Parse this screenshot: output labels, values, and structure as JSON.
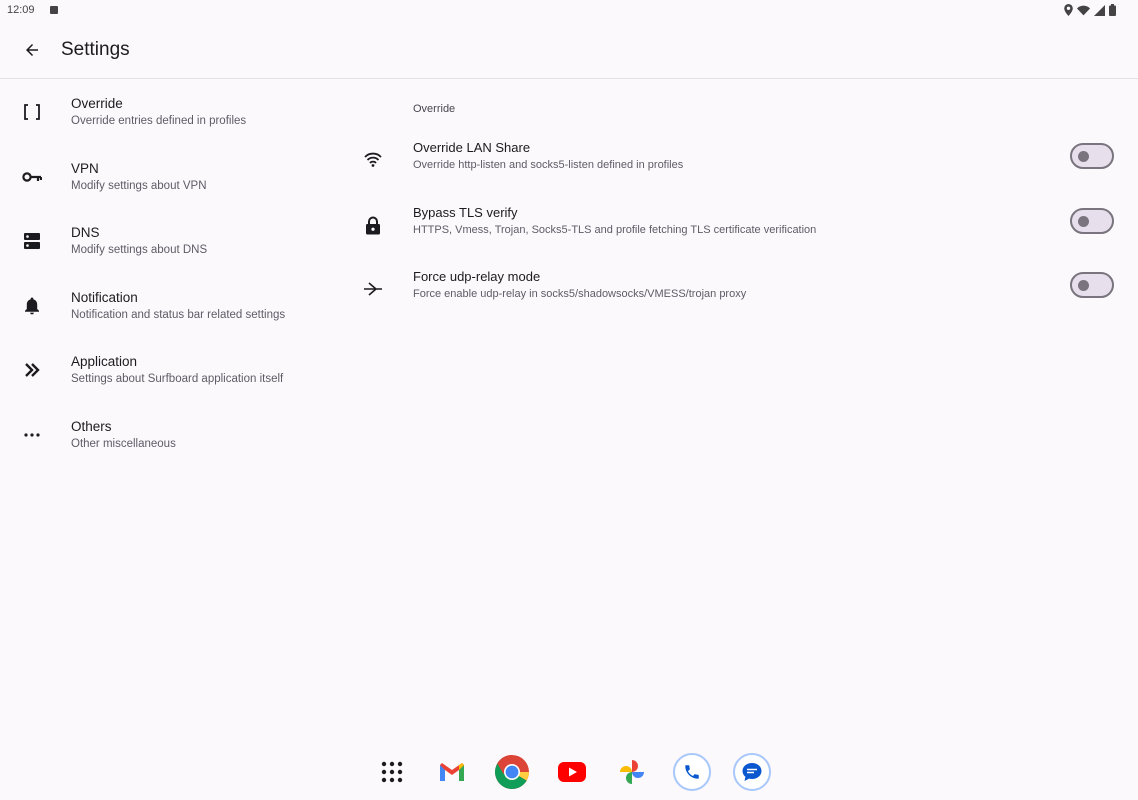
{
  "status_bar": {
    "time": "12:09",
    "icons": [
      "location-icon",
      "wifi-icon",
      "signal-icon",
      "battery-icon"
    ]
  },
  "app_bar": {
    "title": "Settings",
    "back_icon": "arrow-back-icon"
  },
  "categories": [
    {
      "icon": "brackets-icon",
      "title": "Override",
      "subtitle": "Override entries defined in profiles"
    },
    {
      "icon": "key-icon",
      "title": "VPN",
      "subtitle": "Modify settings about VPN"
    },
    {
      "icon": "dns-icon",
      "title": "DNS",
      "subtitle": "Modify settings about DNS"
    },
    {
      "icon": "bell-icon",
      "title": "Notification",
      "subtitle": "Notification and status bar related settings"
    },
    {
      "icon": "double-chevron-icon",
      "title": "Application",
      "subtitle": "Settings about Surfboard application itself"
    },
    {
      "icon": "more-horiz-icon",
      "title": "Others",
      "subtitle": "Other miscellaneous"
    }
  ],
  "detail": {
    "section_title": "Override",
    "prefs": [
      {
        "icon": "wifi-share-icon",
        "title": "Override LAN Share",
        "subtitle": "Override http-listen and socks5-listen defined in profiles",
        "enabled": false
      },
      {
        "icon": "lock-icon",
        "title": "Bypass TLS verify",
        "subtitle": "HTTPS, Vmess, Trojan, Socks5-TLS and profile fetching TLS certificate verification",
        "enabled": false
      },
      {
        "icon": "relay-icon",
        "title": "Force udp-relay mode",
        "subtitle": "Force enable udp-relay in socks5/shadowsocks/VMESS/trojan proxy",
        "enabled": false
      }
    ]
  },
  "taskbar": {
    "apps": [
      "app-drawer-icon",
      "gmail-icon",
      "chrome-icon",
      "youtube-icon",
      "photos-icon",
      "phone-icon",
      "messages-icon"
    ]
  },
  "colors": {
    "background": "#fcf9fd",
    "toggle_off_track": "#e7e0ec",
    "toggle_off_border": "#79747e"
  }
}
